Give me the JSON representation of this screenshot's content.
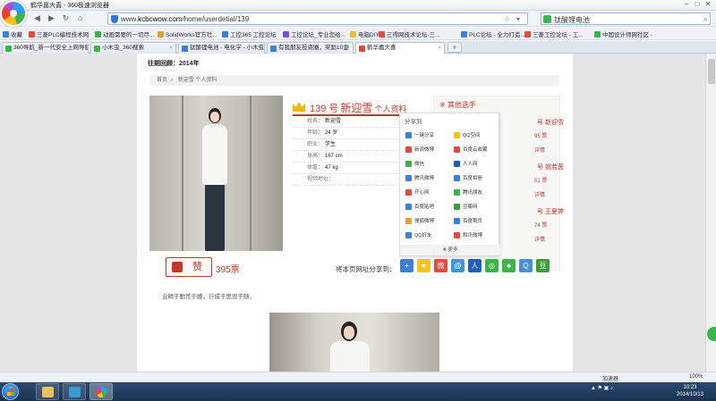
{
  "window": {
    "title": "鹤华嘉大喜 - 360极速浏览器",
    "btn_min": "–",
    "btn_max": "□",
    "btn_close": "✕"
  },
  "address": {
    "url_prefix": "www.",
    "url_host": "kcbcwow.com",
    "url_path": "/home/userdetial/139",
    "search_text": "钛酸锂电池",
    "back": "◀",
    "forward": "▶",
    "refresh": "↻",
    "home": "⌂"
  },
  "bookmarks": [
    {
      "label": "收藏",
      "color": "#3b7fd6"
    },
    {
      "label": "三菱PLC编程技术网",
      "color": "#e24a3b"
    },
    {
      "label": "动画需要的一切尽...",
      "color": "#3bb54a"
    },
    {
      "label": "SolidWorks官方社...",
      "color": "#e2a03b"
    },
    {
      "label": "工控365 工控论坛",
      "color": "#3b7fd6"
    },
    {
      "label": "工控论坛_专业您给...",
      "color": "#7a4fd6"
    },
    {
      "label": "电脑DIY区 -",
      "color": "#e2c23b"
    },
    {
      "label": "三得网技术论坛-三...",
      "color": "#e24a3b"
    },
    {
      "label": "PLC论坛 - 全力打造...",
      "color": "#3b7fd6"
    },
    {
      "label": "三菱工控论坛 - 工...",
      "color": "#e24a3b"
    },
    {
      "label": "中国设计师网社区 -",
      "color": "#3bb54a"
    }
  ],
  "tabs": [
    {
      "label": "360导航_新一代安全上网导航",
      "color": "#3bb54a"
    },
    {
      "label": "小木虫_360搜索",
      "color": "#3bb54a"
    },
    {
      "label": "钛酸锂电池 - 电化学 - 小木虫",
      "color": "#3b7fd6"
    },
    {
      "label": "有我朋友投资圈，奖励10金",
      "color": "#3b7fd6"
    },
    {
      "label": "鹤华嘉大喜",
      "color": "#e24a3b",
      "active": true
    }
  ],
  "page": {
    "ref_time": "往期回顾：2014年",
    "breadcrumb": [
      "首页",
      "新迎雪 个人资料"
    ],
    "profile": {
      "number": "139 号",
      "name": "新迎雪",
      "suffix": "个人资料",
      "rows": [
        {
          "k": "姓名：",
          "v": "新迎雪"
        },
        {
          "k": "年龄：",
          "v": "24 岁"
        },
        {
          "k": "职业：",
          "v": "学生"
        },
        {
          "k": "身高：",
          "v": "167 cm"
        },
        {
          "k": "体重：",
          "v": "47 kg"
        },
        {
          "k": "视频地址：",
          "v": ""
        }
      ]
    },
    "other": {
      "heading": "※ 其他选手",
      "items": [
        {
          "label": "号 新迎雪",
          "sub": "95 票",
          "detail": "详情"
        },
        {
          "label": "号 姚若茵",
          "sub": "51 票",
          "detail": "详情"
        },
        {
          "label": "号 王夏婷",
          "sub": "74 票",
          "detail": "详情"
        }
      ]
    },
    "share_popup": {
      "heading": "分享到",
      "items": [
        {
          "label": "一键分享",
          "color": "#3b7fd6"
        },
        {
          "label": "QQ空间",
          "color": "#f6c21b"
        },
        {
          "label": "新浪微博",
          "color": "#e24a3b"
        },
        {
          "label": "百度云收藏",
          "color": "#e24a3b"
        },
        {
          "label": "微信",
          "color": "#3bb54a"
        },
        {
          "label": "人人网",
          "color": "#1f5fb4"
        },
        {
          "label": "腾讯微博",
          "color": "#3b7fd6"
        },
        {
          "label": "百度相册",
          "color": "#3b7fd6"
        },
        {
          "label": "开心网",
          "color": "#e24a3b"
        },
        {
          "label": "腾讯朋友",
          "color": "#3bb54a"
        },
        {
          "label": "百度贴吧",
          "color": "#3b7fd6"
        },
        {
          "label": "豆瓣网",
          "color": "#3b9e3b"
        },
        {
          "label": "搜狐微博",
          "color": "#e2a03b"
        },
        {
          "label": "百度首页",
          "color": "#3b7fd6"
        },
        {
          "label": "QQ好友",
          "color": "#3b7fd6"
        },
        {
          "label": "和讯微博",
          "color": "#e24a3b"
        }
      ],
      "more": "更多"
    },
    "like_label": "赞",
    "votes": "395票",
    "share_label": "将本页网址分享到：",
    "share_icons": [
      {
        "name": "plus",
        "glyph": "+",
        "color": "#3b7fd6"
      },
      {
        "name": "qzone",
        "glyph": "★",
        "color": "#f6c21b"
      },
      {
        "name": "weibo",
        "glyph": "微",
        "color": "#e24a3b"
      },
      {
        "name": "tqq",
        "glyph": "@",
        "color": "#3b9ad6"
      },
      {
        "name": "renren",
        "glyph": "人",
        "color": "#1f5fb4"
      },
      {
        "name": "wechat",
        "glyph": "◎",
        "color": "#3bb54a"
      },
      {
        "name": "kaixin",
        "glyph": "♣",
        "color": "#3bb54a"
      },
      {
        "name": "qq",
        "glyph": "Q",
        "color": "#4a90d6"
      },
      {
        "name": "douban",
        "glyph": "豆",
        "color": "#3b9e3b"
      }
    ],
    "motto": "业精于勤荒于嬉，行成于思毁于随。"
  },
  "status": {
    "accelerator": "加速器",
    "zoom": "100%"
  },
  "taskbar": {
    "time": "10:23",
    "date": "2014/10/13"
  }
}
